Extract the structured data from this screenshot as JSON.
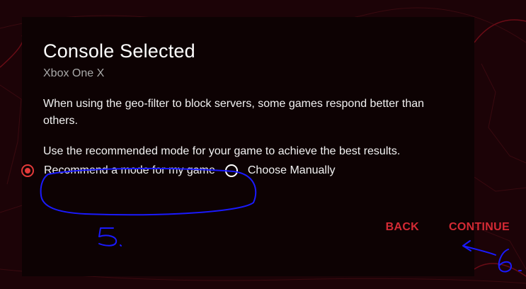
{
  "dialog": {
    "title": "Console Selected",
    "subtitle": "Xbox One X",
    "paragraph_1": "When using the geo-filter to block servers, some games respond better than others.",
    "paragraph_2": "Use the recommended mode for your game to achieve the best results."
  },
  "mode_options": [
    {
      "label": "Recommend a mode for my game",
      "selected": true
    },
    {
      "label": "Choose Manually",
      "selected": false
    }
  ],
  "actions": {
    "back_label": "BACK",
    "continue_label": "CONTINUE"
  },
  "colors": {
    "accent": "#d42a34",
    "dialog_bg": "#0d0203",
    "backdrop_bg": "#1c0307",
    "annotation": "#1a1aff"
  }
}
